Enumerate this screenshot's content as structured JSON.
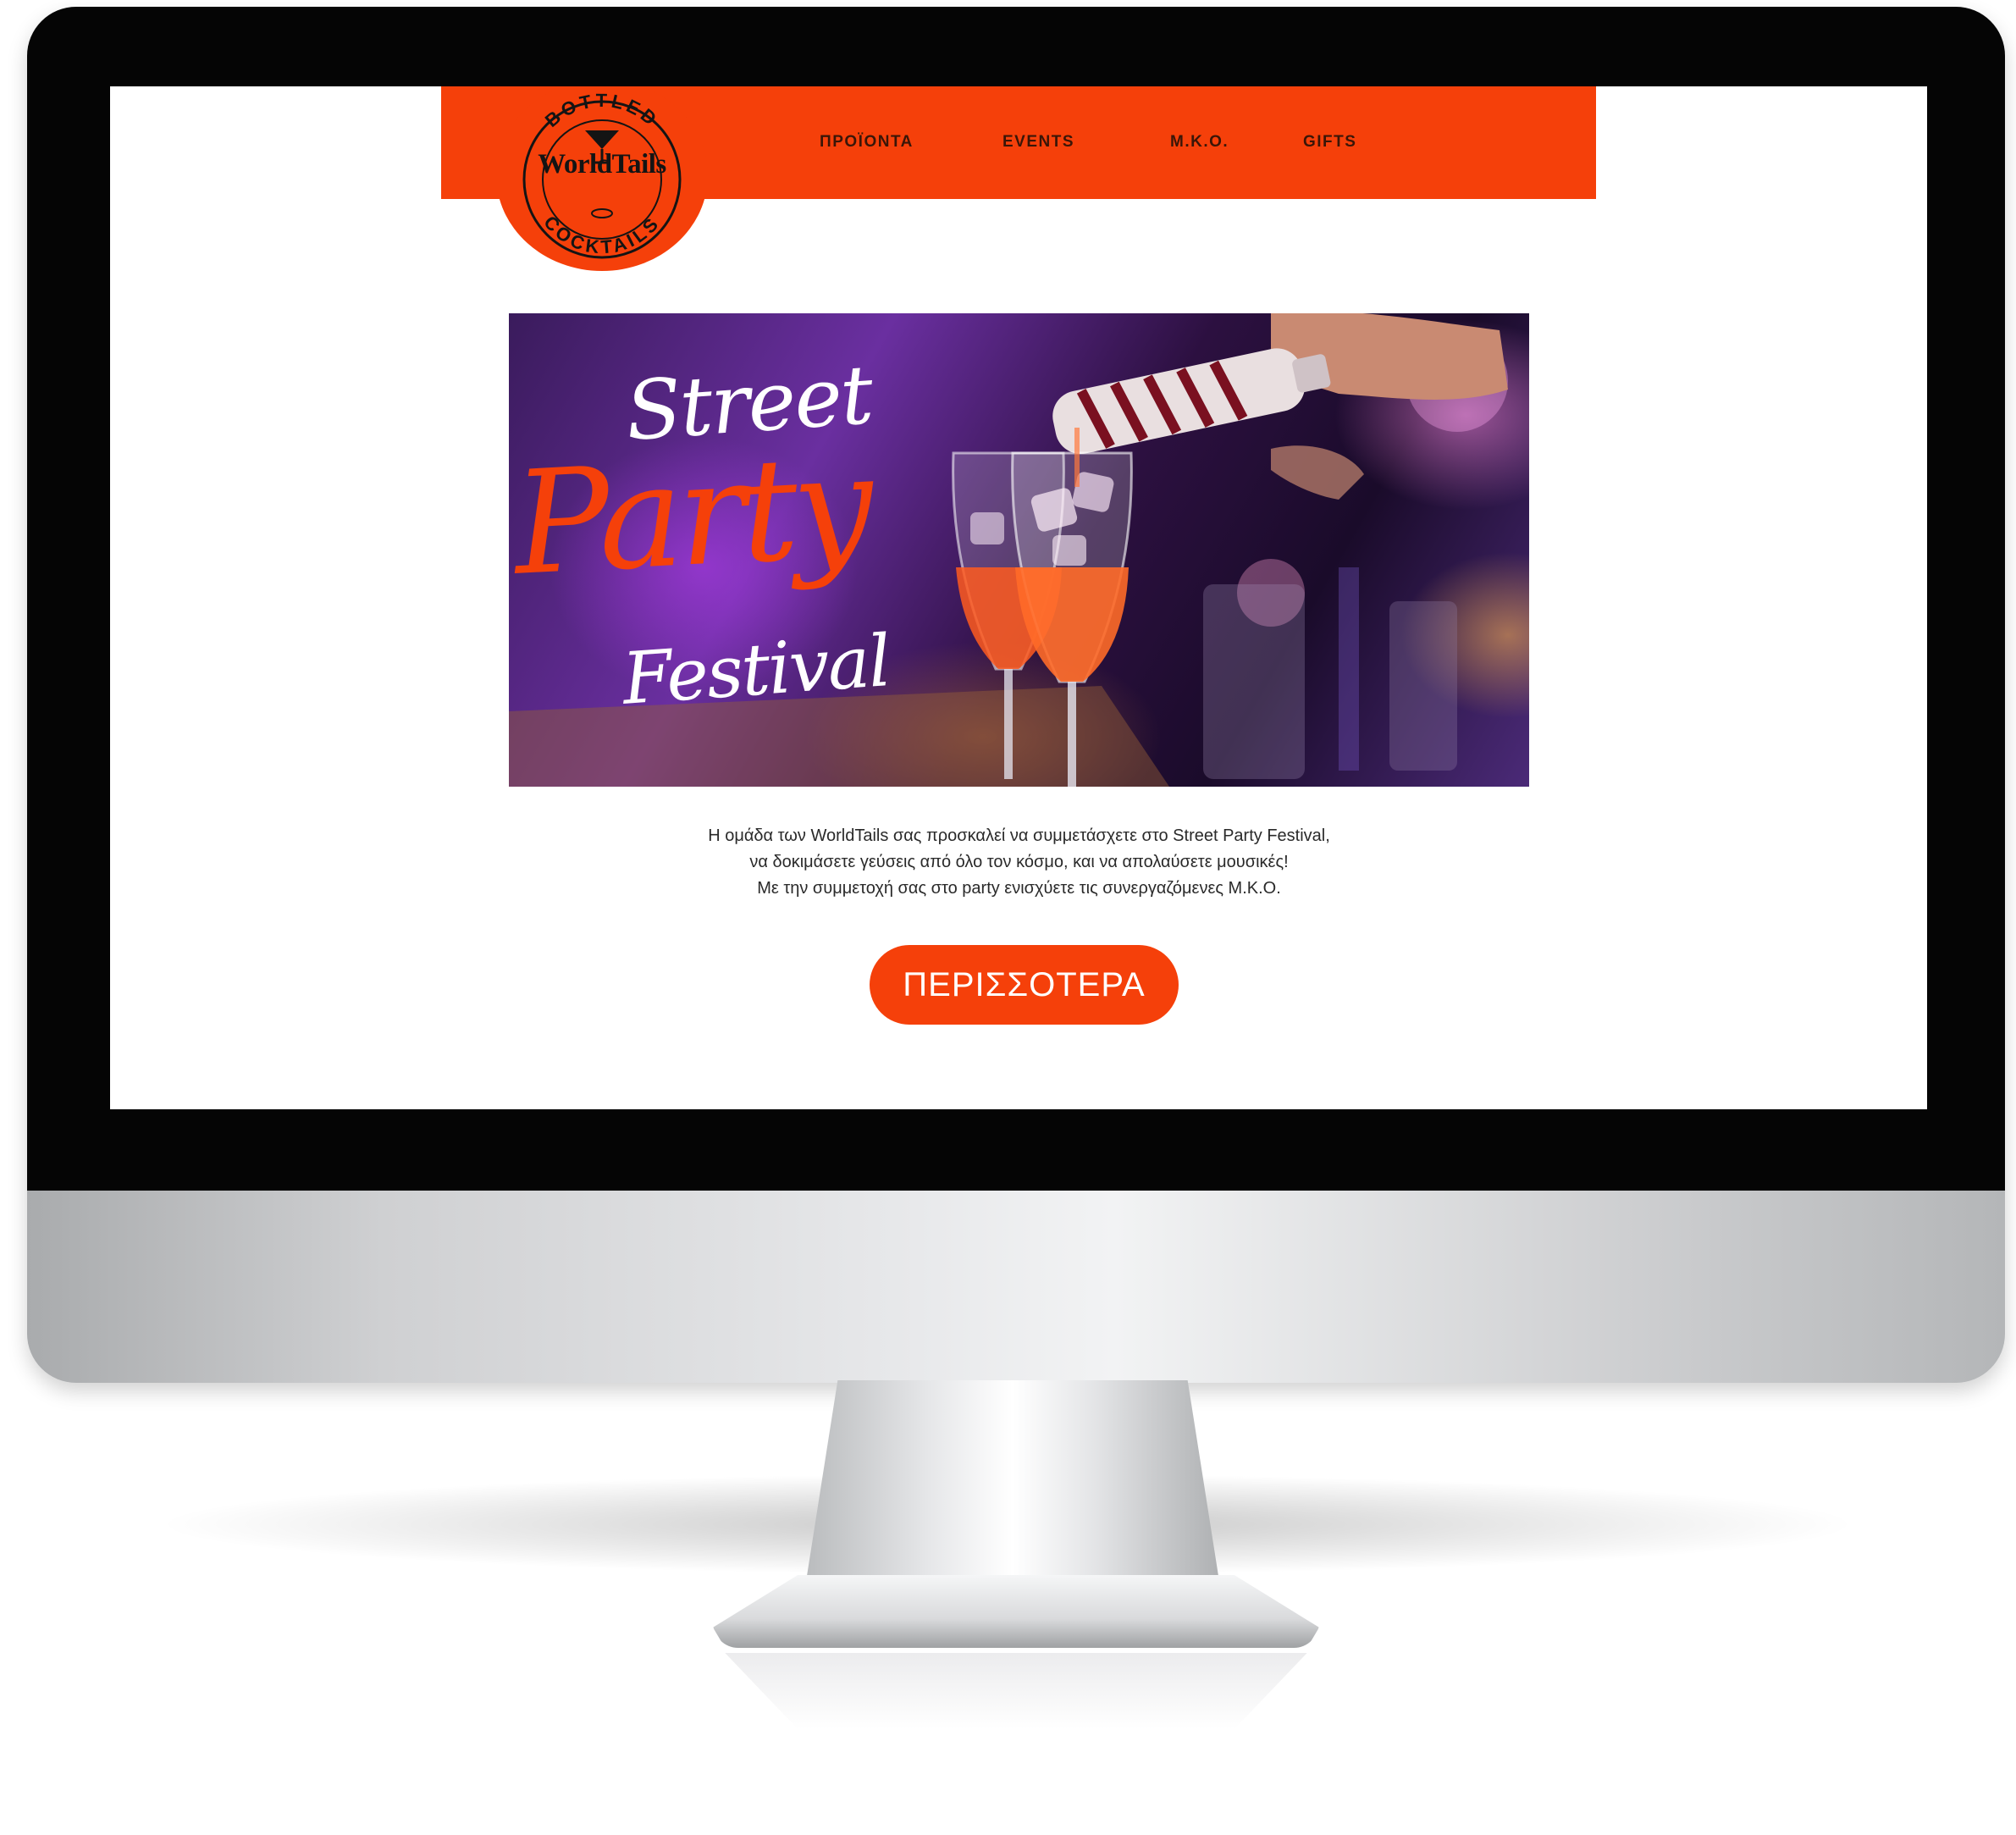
{
  "brand": {
    "top_arc_text": "BOTTLED",
    "name": "WorldTails",
    "bottom_arc_text": "COCKTAILS",
    "color": "#f5400a"
  },
  "nav": {
    "items": [
      {
        "label": "ΠΡΟΪΟΝΤΑ"
      },
      {
        "label": "EVENTS"
      },
      {
        "label": "M.K.O."
      },
      {
        "label": "GIFTS"
      }
    ]
  },
  "hero": {
    "line1": "Street",
    "line2": "Party",
    "line3": "Festival"
  },
  "intro": {
    "lines": [
      "Η ομάδα των WorldTails σας προσκαλεί να συμμετάσχετε στο Street Party Festival,",
      "να δοκιμάσετε γεύσεις από όλο τον κόσμο, και να απολαύσετε μουσικές!",
      "Με την συμμετοχή σας στο party ενισχύετε τις συνεργαζόμενες Μ.Κ.Ο."
    ]
  },
  "cta": {
    "label": "ΠΕΡΙΣΣΟΤΕΡΑ"
  },
  "icons": {
    "logo": "cocktail-glass-icon"
  }
}
